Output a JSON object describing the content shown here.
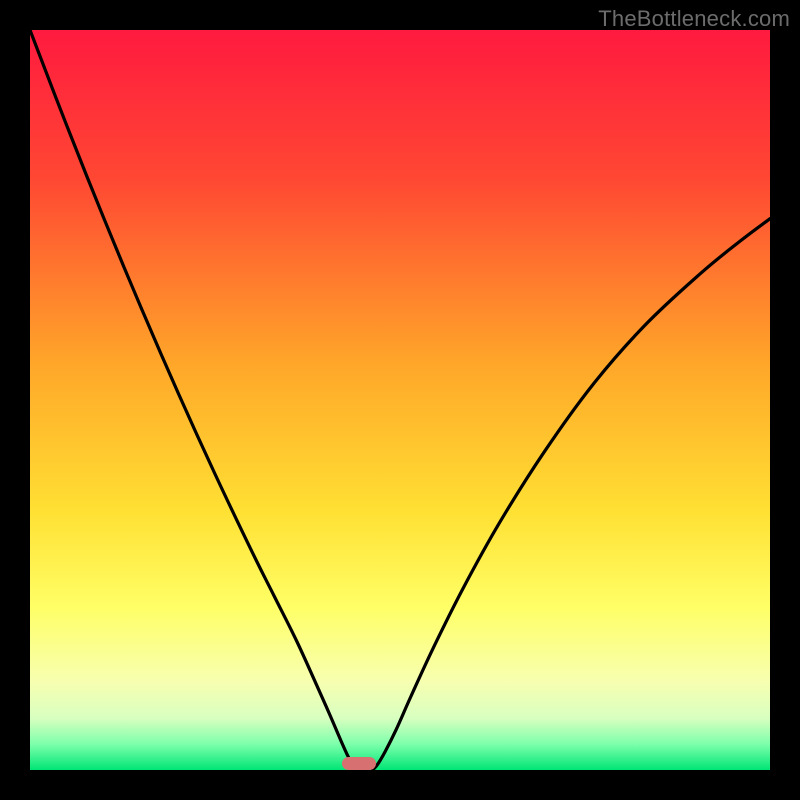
{
  "watermark": "TheBottleneck.com",
  "marker": {
    "x_frac": 0.43,
    "y_frac": 0.985
  },
  "chart_data": {
    "type": "line",
    "title": "",
    "xlabel": "",
    "ylabel": "",
    "xlim": [
      0,
      1
    ],
    "ylim": [
      0,
      1
    ],
    "gradient_stops": [
      {
        "offset": 0.0,
        "color": "#ff1a3f"
      },
      {
        "offset": 0.2,
        "color": "#ff4733"
      },
      {
        "offset": 0.45,
        "color": "#ffa629"
      },
      {
        "offset": 0.65,
        "color": "#ffe033"
      },
      {
        "offset": 0.78,
        "color": "#ffff66"
      },
      {
        "offset": 0.88,
        "color": "#f7ffb0"
      },
      {
        "offset": 0.93,
        "color": "#d8ffc0"
      },
      {
        "offset": 0.965,
        "color": "#7dffab"
      },
      {
        "offset": 1.0,
        "color": "#00e676"
      }
    ],
    "series": [
      {
        "name": "left_curve",
        "x": [
          0.0,
          0.05,
          0.1,
          0.15,
          0.2,
          0.25,
          0.3,
          0.33,
          0.36,
          0.385,
          0.405,
          0.42,
          0.43,
          0.437,
          0.443
        ],
        "y": [
          1.0,
          0.87,
          0.745,
          0.625,
          0.51,
          0.4,
          0.295,
          0.235,
          0.175,
          0.12,
          0.075,
          0.04,
          0.018,
          0.006,
          0.0
        ]
      },
      {
        "name": "right_curve",
        "x": [
          0.463,
          0.47,
          0.48,
          0.495,
          0.515,
          0.545,
          0.585,
          0.635,
          0.695,
          0.76,
          0.83,
          0.905,
          0.96,
          1.0
        ],
        "y": [
          0.0,
          0.008,
          0.025,
          0.055,
          0.1,
          0.165,
          0.245,
          0.335,
          0.43,
          0.52,
          0.6,
          0.67,
          0.715,
          0.745
        ]
      }
    ],
    "marker": {
      "x": 0.445,
      "y": 0.0,
      "width_frac": 0.046,
      "height_frac": 0.018,
      "color": "#d77070"
    }
  }
}
